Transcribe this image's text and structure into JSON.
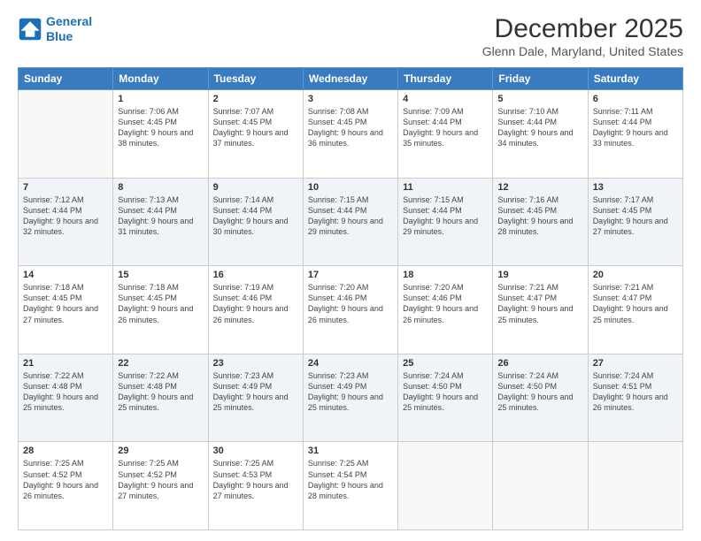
{
  "logo": {
    "line1": "General",
    "line2": "Blue"
  },
  "title": "December 2025",
  "subtitle": "Glenn Dale, Maryland, United States",
  "days_header": [
    "Sunday",
    "Monday",
    "Tuesday",
    "Wednesday",
    "Thursday",
    "Friday",
    "Saturday"
  ],
  "weeks": [
    {
      "cells": [
        {
          "date": "",
          "sunrise": "",
          "sunset": "",
          "daylight": ""
        },
        {
          "date": "1",
          "sunrise": "7:06 AM",
          "sunset": "4:45 PM",
          "daylight": "9 hours and 38 minutes."
        },
        {
          "date": "2",
          "sunrise": "7:07 AM",
          "sunset": "4:45 PM",
          "daylight": "9 hours and 37 minutes."
        },
        {
          "date": "3",
          "sunrise": "7:08 AM",
          "sunset": "4:45 PM",
          "daylight": "9 hours and 36 minutes."
        },
        {
          "date": "4",
          "sunrise": "7:09 AM",
          "sunset": "4:44 PM",
          "daylight": "9 hours and 35 minutes."
        },
        {
          "date": "5",
          "sunrise": "7:10 AM",
          "sunset": "4:44 PM",
          "daylight": "9 hours and 34 minutes."
        },
        {
          "date": "6",
          "sunrise": "7:11 AM",
          "sunset": "4:44 PM",
          "daylight": "9 hours and 33 minutes."
        }
      ]
    },
    {
      "cells": [
        {
          "date": "7",
          "sunrise": "7:12 AM",
          "sunset": "4:44 PM",
          "daylight": "9 hours and 32 minutes."
        },
        {
          "date": "8",
          "sunrise": "7:13 AM",
          "sunset": "4:44 PM",
          "daylight": "9 hours and 31 minutes."
        },
        {
          "date": "9",
          "sunrise": "7:14 AM",
          "sunset": "4:44 PM",
          "daylight": "9 hours and 30 minutes."
        },
        {
          "date": "10",
          "sunrise": "7:15 AM",
          "sunset": "4:44 PM",
          "daylight": "9 hours and 29 minutes."
        },
        {
          "date": "11",
          "sunrise": "7:15 AM",
          "sunset": "4:44 PM",
          "daylight": "9 hours and 29 minutes."
        },
        {
          "date": "12",
          "sunrise": "7:16 AM",
          "sunset": "4:45 PM",
          "daylight": "9 hours and 28 minutes."
        },
        {
          "date": "13",
          "sunrise": "7:17 AM",
          "sunset": "4:45 PM",
          "daylight": "9 hours and 27 minutes."
        }
      ]
    },
    {
      "cells": [
        {
          "date": "14",
          "sunrise": "7:18 AM",
          "sunset": "4:45 PM",
          "daylight": "9 hours and 27 minutes."
        },
        {
          "date": "15",
          "sunrise": "7:18 AM",
          "sunset": "4:45 PM",
          "daylight": "9 hours and 26 minutes."
        },
        {
          "date": "16",
          "sunrise": "7:19 AM",
          "sunset": "4:46 PM",
          "daylight": "9 hours and 26 minutes."
        },
        {
          "date": "17",
          "sunrise": "7:20 AM",
          "sunset": "4:46 PM",
          "daylight": "9 hours and 26 minutes."
        },
        {
          "date": "18",
          "sunrise": "7:20 AM",
          "sunset": "4:46 PM",
          "daylight": "9 hours and 26 minutes."
        },
        {
          "date": "19",
          "sunrise": "7:21 AM",
          "sunset": "4:47 PM",
          "daylight": "9 hours and 25 minutes."
        },
        {
          "date": "20",
          "sunrise": "7:21 AM",
          "sunset": "4:47 PM",
          "daylight": "9 hours and 25 minutes."
        }
      ]
    },
    {
      "cells": [
        {
          "date": "21",
          "sunrise": "7:22 AM",
          "sunset": "4:48 PM",
          "daylight": "9 hours and 25 minutes."
        },
        {
          "date": "22",
          "sunrise": "7:22 AM",
          "sunset": "4:48 PM",
          "daylight": "9 hours and 25 minutes."
        },
        {
          "date": "23",
          "sunrise": "7:23 AM",
          "sunset": "4:49 PM",
          "daylight": "9 hours and 25 minutes."
        },
        {
          "date": "24",
          "sunrise": "7:23 AM",
          "sunset": "4:49 PM",
          "daylight": "9 hours and 25 minutes."
        },
        {
          "date": "25",
          "sunrise": "7:24 AM",
          "sunset": "4:50 PM",
          "daylight": "9 hours and 25 minutes."
        },
        {
          "date": "26",
          "sunrise": "7:24 AM",
          "sunset": "4:50 PM",
          "daylight": "9 hours and 25 minutes."
        },
        {
          "date": "27",
          "sunrise": "7:24 AM",
          "sunset": "4:51 PM",
          "daylight": "9 hours and 26 minutes."
        }
      ]
    },
    {
      "cells": [
        {
          "date": "28",
          "sunrise": "7:25 AM",
          "sunset": "4:52 PM",
          "daylight": "9 hours and 26 minutes."
        },
        {
          "date": "29",
          "sunrise": "7:25 AM",
          "sunset": "4:52 PM",
          "daylight": "9 hours and 27 minutes."
        },
        {
          "date": "30",
          "sunrise": "7:25 AM",
          "sunset": "4:53 PM",
          "daylight": "9 hours and 27 minutes."
        },
        {
          "date": "31",
          "sunrise": "7:25 AM",
          "sunset": "4:54 PM",
          "daylight": "9 hours and 28 minutes."
        },
        {
          "date": "",
          "sunrise": "",
          "sunset": "",
          "daylight": ""
        },
        {
          "date": "",
          "sunrise": "",
          "sunset": "",
          "daylight": ""
        },
        {
          "date": "",
          "sunrise": "",
          "sunset": "",
          "daylight": ""
        }
      ]
    }
  ],
  "labels": {
    "sunrise_prefix": "Sunrise: ",
    "sunset_prefix": "Sunset: ",
    "daylight_prefix": "Daylight: "
  }
}
